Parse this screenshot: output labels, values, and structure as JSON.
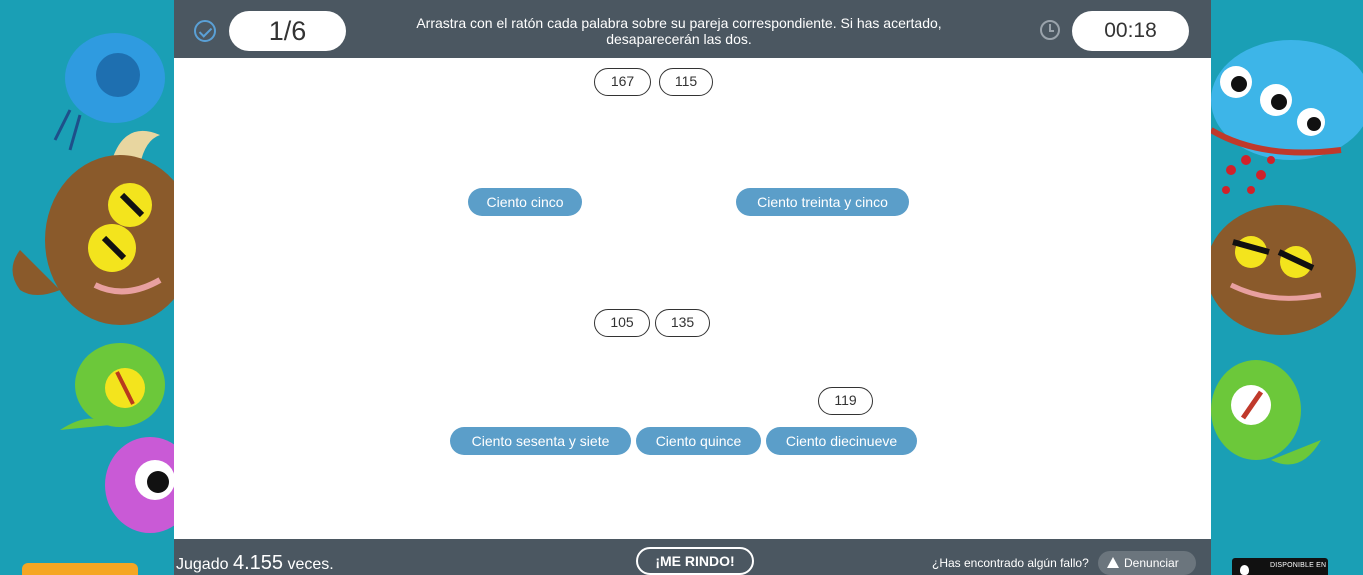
{
  "header": {
    "progress": "1/6",
    "instructions": "Arrastra con el ratón cada palabra sobre su pareja correspondiente. Si has acertado, desaparecerán las dos.",
    "timer": "00:18"
  },
  "numbers": [
    "167",
    "115",
    "105",
    "135",
    "119"
  ],
  "words": [
    "Ciento cinco",
    "Ciento treinta y cinco",
    "Ciento sesenta y siete",
    "Ciento quince",
    "Ciento diecinueve"
  ],
  "footer": {
    "played_prefix": "Jugado",
    "played_count": "4.155",
    "played_suffix": "veces.",
    "give_up_label": "¡ME RINDO!",
    "report_question": "¿Has encontrado algún fallo?",
    "report_label": "Denunciar",
    "store_badge": "DISPONIBLE EN"
  },
  "colors": {
    "topbar": "#4b5761",
    "word_chip": "#5b9ec9",
    "background": "#1a9fb5",
    "accent": "#f5a623"
  },
  "icons": [
    "check-circle-icon",
    "clock-icon",
    "warning-icon",
    "apple-icon"
  ]
}
